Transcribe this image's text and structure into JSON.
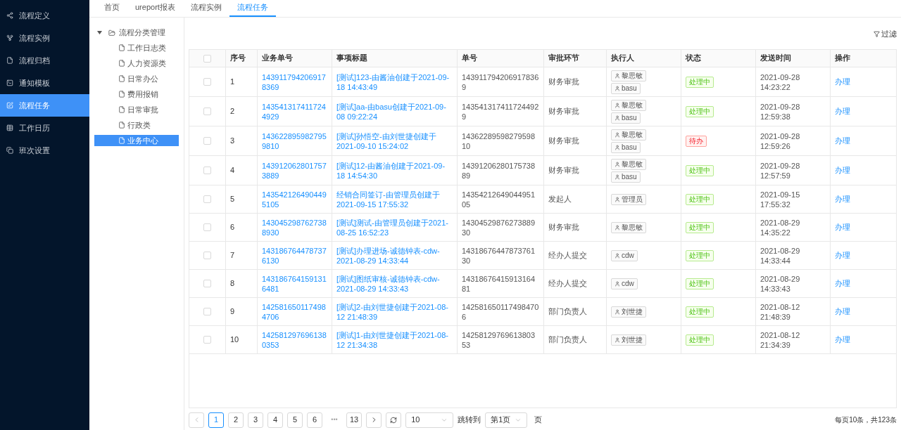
{
  "sidebar": {
    "items": [
      {
        "label": "流程定义",
        "selected": false
      },
      {
        "label": "流程实例",
        "selected": false
      },
      {
        "label": "流程归档",
        "selected": false
      },
      {
        "label": "通知模板",
        "selected": false
      },
      {
        "label": "流程任务",
        "selected": true
      },
      {
        "label": "工作日历",
        "selected": false
      },
      {
        "label": "班次设置",
        "selected": false
      }
    ]
  },
  "tabs": [
    {
      "label": "首页",
      "selected": false
    },
    {
      "label": "ureport报表",
      "selected": false
    },
    {
      "label": "流程实例",
      "selected": false
    },
    {
      "label": "流程任务",
      "selected": true
    }
  ],
  "tree": {
    "label": "流程分类管理",
    "expanded": true,
    "children": [
      {
        "label": "工作日志类",
        "selected": false
      },
      {
        "label": "人力资源类",
        "selected": false
      },
      {
        "label": "日常办公",
        "selected": false
      },
      {
        "label": "费用报销",
        "selected": false
      },
      {
        "label": "日常审批",
        "selected": false
      },
      {
        "label": "行政类",
        "selected": false
      },
      {
        "label": "业务中心",
        "selected": true
      }
    ]
  },
  "filter_button": "过滤",
  "table": {
    "select_all_checked": false,
    "columns": [
      "序号",
      "业务单号",
      "事项标题",
      "单号",
      "审批环节",
      "执行人",
      "状态",
      "发送时间",
      "操作"
    ],
    "rows": [
      {
        "index": "1",
        "business_no": "1439117942069178369",
        "title": "[测试]123-由酱油创建于2021-09-18 14:43:49",
        "no": "1439117942069178369",
        "stage": "财务审批",
        "assignees": [
          "黎思敏",
          "basu"
        ],
        "status": {
          "label": "处理中",
          "kind": "processing"
        },
        "time": "2021-09-28 14:23:22",
        "action": "办理",
        "checked": false
      },
      {
        "index": "2",
        "business_no": "1435413174117244929",
        "title": "[测试]aa-由basu创建于2021-09-08 09:22:24",
        "no": "1435413174117244929",
        "stage": "财务审批",
        "assignees": [
          "黎思敏",
          "basu"
        ],
        "status": {
          "label": "处理中",
          "kind": "processing"
        },
        "time": "2021-09-28 12:59:38",
        "action": "办理",
        "checked": false
      },
      {
        "index": "3",
        "business_no": "1436228959827959810",
        "title": "[测试]孙悟空-由刘世捷创建于2021-09-10 15:24:02",
        "no": "1436228959827959810",
        "stage": "财务审批",
        "assignees": [
          "黎思敏",
          "basu"
        ],
        "status": {
          "label": "待办",
          "kind": "todo"
        },
        "time": "2021-09-28 12:59:26",
        "action": "办理",
        "checked": false
      },
      {
        "index": "4",
        "business_no": "1439120628017573889",
        "title": "[测试]12-由酱油创建于2021-09-18 14:54:30",
        "no": "1439120628017573889",
        "stage": "财务审批",
        "assignees": [
          "黎思敏",
          "basu"
        ],
        "status": {
          "label": "处理中",
          "kind": "processing"
        },
        "time": "2021-09-28 12:57:59",
        "action": "办理",
        "checked": false
      },
      {
        "index": "5",
        "business_no": "1435421264904495105",
        "title": "经销合同签订-由管理员创建于2021-09-15 17:55:32",
        "no": "1435421264904495105",
        "stage": "发起人",
        "assignees": [
          "管理员"
        ],
        "status": {
          "label": "处理中",
          "kind": "processing"
        },
        "time": "2021-09-15 17:55:32",
        "action": "办理",
        "checked": false
      },
      {
        "index": "6",
        "business_no": "1430452987627388930",
        "title": "[测试]测试-由管理员创建于2021-08-25 16:52:23",
        "no": "1430452987627388930",
        "stage": "财务审批",
        "assignees": [
          "黎思敏"
        ],
        "status": {
          "label": "处理中",
          "kind": "processing"
        },
        "time": "2021-08-29 14:35:22",
        "action": "办理",
        "checked": false
      },
      {
        "index": "7",
        "business_no": "1431867644787376130",
        "title": "[测试]办理进场-诚德钟表-cdw-2021-08-29 14:33:44",
        "no": "1431867644787376130",
        "stage": "经办人提交",
        "assignees": [
          "cdw"
        ],
        "status": {
          "label": "处理中",
          "kind": "processing"
        },
        "time": "2021-08-29 14:33:44",
        "action": "办理",
        "checked": false
      },
      {
        "index": "8",
        "business_no": "1431867641591316481",
        "title": "[测试]图纸审核-诚德钟表-cdw-2021-08-29 14:33:43",
        "no": "1431867641591316481",
        "stage": "经办人提交",
        "assignees": [
          "cdw"
        ],
        "status": {
          "label": "处理中",
          "kind": "processing"
        },
        "time": "2021-08-29 14:33:43",
        "action": "办理",
        "checked": false
      },
      {
        "index": "9",
        "business_no": "1425816501174984706",
        "title": "[测试]2-由刘世捷创建于2021-08-12 21:48:39",
        "no": "1425816501174984706",
        "stage": "部门负责人",
        "assignees": [
          "刘世捷"
        ],
        "status": {
          "label": "处理中",
          "kind": "processing"
        },
        "time": "2021-08-12 21:48:39",
        "action": "办理",
        "checked": false
      },
      {
        "index": "10",
        "business_no": "1425812976961380353",
        "title": "[测试]1-由刘世捷创建于2021-08-12 21:34:38",
        "no": "1425812976961380353",
        "stage": "部门负责人",
        "assignees": [
          "刘世捷"
        ],
        "status": {
          "label": "处理中",
          "kind": "processing"
        },
        "time": "2021-08-12 21:34:39",
        "action": "办理",
        "checked": false
      }
    ]
  },
  "pagination": {
    "pages": [
      {
        "label": "1",
        "selected": true
      },
      {
        "label": "2",
        "selected": false
      },
      {
        "label": "3",
        "selected": false
      },
      {
        "label": "4",
        "selected": false
      },
      {
        "label": "5",
        "selected": false
      },
      {
        "label": "6",
        "selected": false
      },
      {
        "label": "•••",
        "kind": "ellipsis"
      },
      {
        "label": "13",
        "selected": false
      }
    ],
    "page_size": "10",
    "jump_label": "跳转到",
    "jump_value": "第1页",
    "jump_suffix": "页",
    "summary": "每页10条，共123条"
  }
}
